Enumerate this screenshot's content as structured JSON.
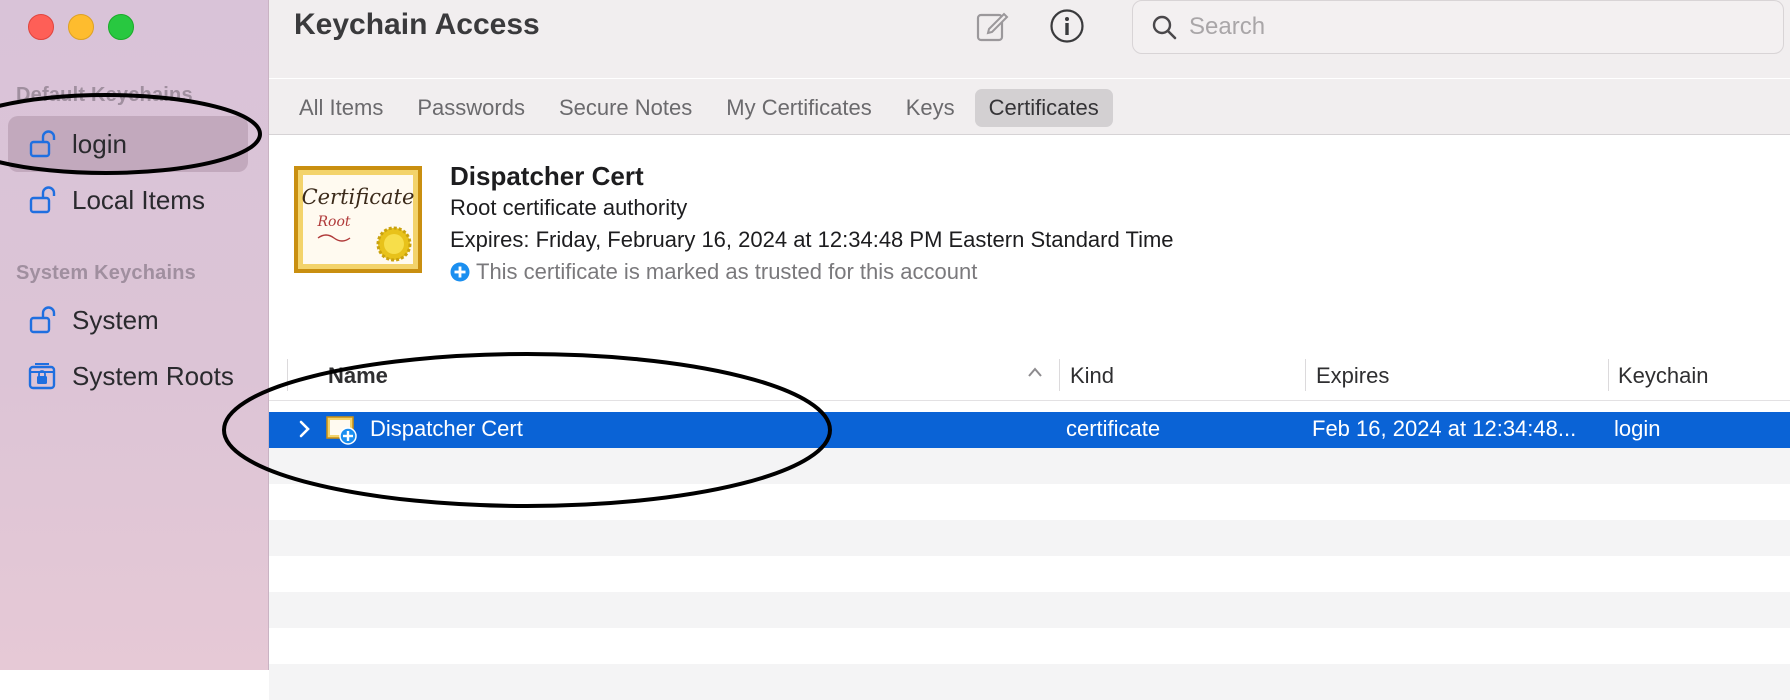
{
  "window": {
    "title": "Keychain Access",
    "search_placeholder": "Search"
  },
  "sidebar": {
    "default_heading": "Default Keychains",
    "default_items": [
      {
        "label": "login",
        "icon": "unlocked-padlock-icon",
        "selected": true
      },
      {
        "label": "Local Items",
        "icon": "unlocked-padlock-icon"
      }
    ],
    "system_heading": "System Keychains",
    "system_items": [
      {
        "label": "System",
        "icon": "unlocked-padlock-icon"
      },
      {
        "label": "System Roots",
        "icon": "locked-cabinet-icon"
      }
    ]
  },
  "tabs": [
    {
      "label": "All Items"
    },
    {
      "label": "Passwords"
    },
    {
      "label": "Secure Notes"
    },
    {
      "label": "My Certificates"
    },
    {
      "label": "Keys"
    },
    {
      "label": "Certificates",
      "active": true
    }
  ],
  "detail": {
    "name": "Dispatcher Cert",
    "type": "Root certificate authority",
    "expires": "Expires: Friday, February 16, 2024 at 12:34:48 PM Eastern Standard Time",
    "trust": "This certificate is marked as trusted for this account",
    "image_text_1": "Certificate",
    "image_text_2": "Root"
  },
  "table": {
    "columns": {
      "name": "Name",
      "kind": "Kind",
      "expires": "Expires",
      "keychain": "Keychain"
    },
    "rows": [
      {
        "name": "Dispatcher Cert",
        "kind": "certificate",
        "expires": "Feb 16, 2024 at 12:34:48...",
        "keychain": "login",
        "selected": true
      }
    ]
  },
  "colors": {
    "selection": "#0a63d6",
    "trust_badge": "#1b8ff0",
    "close": "#fe5f57",
    "minimize": "#febc2e",
    "maximize": "#28c840"
  }
}
